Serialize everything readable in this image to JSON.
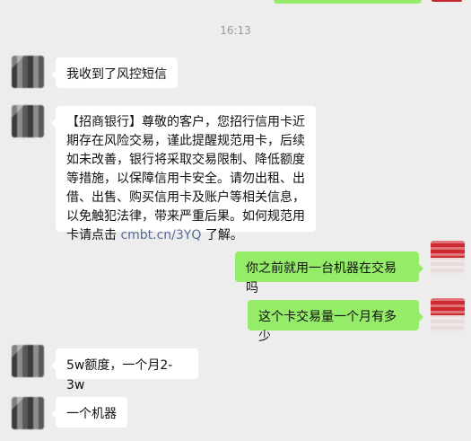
{
  "timestamp": "16:13",
  "messages": [
    {
      "side": "left",
      "text": "我收到了风控短信"
    },
    {
      "side": "left",
      "text_before_link": "【招商银行】尊敬的客户，您招行信用卡近期存在风险交易，谨此提醒规范用卡，后续如未改善，银行将采取交易限制、降低额度等措施，以保障信用卡安全。请勿出租、出借、出售、购买信用卡及账户等相关信息，以免触犯法律，带来严重后果。如何规范用卡请点击 ",
      "link": "cmbt.cn/3YQ",
      "text_after_link": " 了解。"
    },
    {
      "side": "right",
      "text": "你之前就用一台机器在交易吗"
    },
    {
      "side": "right",
      "text": "这个卡交易量一个月有多少"
    },
    {
      "side": "left",
      "text": "5w额度，一个月2-3w"
    },
    {
      "side": "left",
      "text": "一个机器"
    }
  ],
  "colors": {
    "background": "#ededed",
    "left_bubble": "#ffffff",
    "right_bubble": "#95ec69",
    "link": "#576b95",
    "timestamp": "#9a9a9a"
  }
}
